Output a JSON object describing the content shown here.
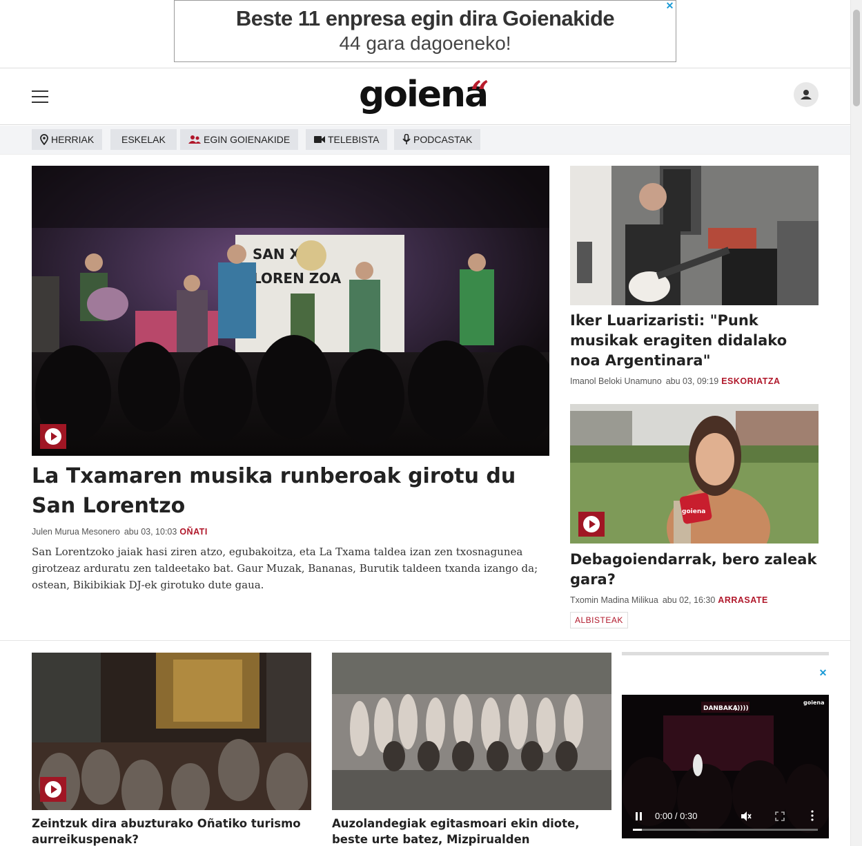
{
  "ad": {
    "line1": "Beste 11 enpresa egin dira Goienakide",
    "line2": "44 gara dagoeneko!",
    "close": "✕"
  },
  "header": {
    "logo": "goiena",
    "logo_mark": "“"
  },
  "nav": [
    {
      "label": "HERRIAK",
      "icon": "location-pin-icon"
    },
    {
      "label": "ESKELAK",
      "icon": ""
    },
    {
      "label": "EGIN GOIENAKIDE",
      "icon": "people-icon"
    },
    {
      "label": "TELEBISTA",
      "icon": "video-camera-icon"
    },
    {
      "label": "PODCASTAK",
      "icon": "microphone-icon"
    }
  ],
  "main_story": {
    "title": "La Txamaren musika runberoak girotu du San Lorentzo",
    "author": "Julen Murua Mesonero",
    "date": "abu 03, 10:03",
    "town": "OÑATI",
    "summary": "San Lorentzoko jaiak hasi ziren atzo, egubakoitza, eta La Txama taldea izan zen txosnagunea girotzeaz arduratu zen taldeetako bat. Gaur Muzak, Bananas, Burutik taldeen txanda izango da; ostean, Bikibikiak DJ-ek girotuko dute gaua.",
    "banner_text": "SAN   XAK",
    "banner_text2": "LOREN   ZOA"
  },
  "side_stories": [
    {
      "title": "Iker Luarizaristi: \"Punk musikak eragiten didalako noa Argentinara\"",
      "author": "Imanol Beloki Unamuno",
      "date": "abu 03, 09:19",
      "town": "ESKORIATZA"
    },
    {
      "title": "Debagoiendarrak, bero zaleak gara?",
      "author": "Txomin Madina Milikua",
      "date": "abu 02, 16:30",
      "town": "ARRASATE",
      "tag": "ALBISTEAK",
      "mic_label": "goiena"
    }
  ],
  "bottom_stories": [
    {
      "title": "Zeintzuk dira abuzturako Oñatiko turismo aurreikuspenak?"
    },
    {
      "title": "Auzolandegiak egitasmoari ekin diote, beste urte batez, Mizpirualden"
    }
  ],
  "video_ad": {
    "time": "0:00 / 0:30",
    "progress": 0.05,
    "sign": "DANBAKA",
    "sign_mark": ")))))",
    "brand": "goiena"
  },
  "colors": {
    "accent": "#b0172a",
    "play_bg": "#a01624",
    "ad_close": "#1a9ad6"
  }
}
